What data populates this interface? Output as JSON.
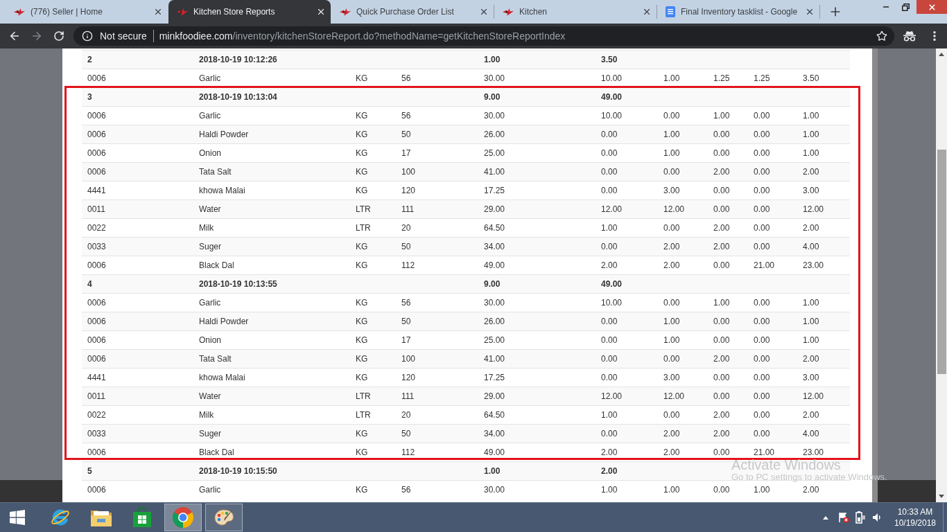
{
  "browser": {
    "tabs": [
      {
        "title": "(776) Seller | Home",
        "kind": "site",
        "selected": false
      },
      {
        "title": "Kitchen Store Reports",
        "kind": "site",
        "selected": true
      },
      {
        "title": "Quick Purchase Order List",
        "kind": "site",
        "selected": false
      },
      {
        "title": "Kitchen",
        "kind": "site",
        "selected": false
      },
      {
        "title": "Final Inventory tasklist - Google",
        "kind": "document",
        "selected": false
      }
    ],
    "navigation": {
      "forward": {
        "disabled": true
      }
    },
    "address_bar": {
      "security": "Not secure",
      "host": "minkfoodiee.com",
      "path": "/inventory/kitchenStoreReport.do?methodName=getKitchenStoreReportIndex"
    }
  },
  "report": {
    "groups": [
      {
        "highlighted": false,
        "header": {
          "column_1": "2",
          "column_2": "2018-10-19 10:12:26",
          "column_5": "1.00",
          "column_6": "3.50"
        },
        "items": [
          {
            "cells": [
              "0006",
              "Garlic",
              "KG",
              "56",
              "30.00",
              "10.00",
              "1.00",
              "1.25",
              "1.25",
              "3.50"
            ]
          }
        ]
      },
      {
        "highlighted": true,
        "header": {
          "column_1": "3",
          "column_2": "2018-10-19 10:13:04",
          "column_5": "9.00",
          "column_6": "49.00"
        },
        "items": [
          {
            "cells": [
              "0006",
              "Garlic",
              "KG",
              "56",
              "30.00",
              "10.00",
              "0.00",
              "1.00",
              "0.00",
              "1.00"
            ]
          },
          {
            "cells": [
              "0006",
              "Haldi Powder",
              "KG",
              "50",
              "26.00",
              "0.00",
              "1.00",
              "0.00",
              "0.00",
              "1.00"
            ]
          },
          {
            "cells": [
              "0006",
              "Onion",
              "KG",
              "17",
              "25.00",
              "0.00",
              "1.00",
              "0.00",
              "0.00",
              "1.00"
            ]
          },
          {
            "cells": [
              "0006",
              "Tata Salt",
              "KG",
              "100",
              "41.00",
              "0.00",
              "0.00",
              "2.00",
              "0.00",
              "2.00"
            ]
          },
          {
            "cells": [
              "4441",
              "khowa Malai",
              "KG",
              "120",
              "17.25",
              "0.00",
              "3.00",
              "0.00",
              "0.00",
              "3.00"
            ]
          },
          {
            "cells": [
              "0011",
              "Water",
              "LTR",
              "111",
              "29.00",
              "12.00",
              "12.00",
              "0.00",
              "0.00",
              "12.00"
            ]
          },
          {
            "cells": [
              "0022",
              "Milk",
              "LTR",
              "20",
              "64.50",
              "1.00",
              "0.00",
              "2.00",
              "0.00",
              "2.00"
            ]
          },
          {
            "cells": [
              "0033",
              "Suger",
              "KG",
              "50",
              "34.00",
              "0.00",
              "2.00",
              "2.00",
              "0.00",
              "4.00"
            ]
          },
          {
            "cells": [
              "0006",
              "Black Dal",
              "KG",
              "112",
              "49.00",
              "2.00",
              "2.00",
              "0.00",
              "21.00",
              "23.00"
            ]
          }
        ]
      },
      {
        "highlighted": true,
        "header": {
          "column_1": "4",
          "column_2": "2018-10-19 10:13:55",
          "column_5": "9.00",
          "column_6": "49.00"
        },
        "items": [
          {
            "cells": [
              "0006",
              "Garlic",
              "KG",
              "56",
              "30.00",
              "10.00",
              "0.00",
              "1.00",
              "0.00",
              "1.00"
            ]
          },
          {
            "cells": [
              "0006",
              "Haldi Powder",
              "KG",
              "50",
              "26.00",
              "0.00",
              "1.00",
              "0.00",
              "0.00",
              "1.00"
            ]
          },
          {
            "cells": [
              "0006",
              "Onion",
              "KG",
              "17",
              "25.00",
              "0.00",
              "1.00",
              "0.00",
              "0.00",
              "1.00"
            ]
          },
          {
            "cells": [
              "0006",
              "Tata Salt",
              "KG",
              "100",
              "41.00",
              "0.00",
              "0.00",
              "2.00",
              "0.00",
              "2.00"
            ]
          },
          {
            "cells": [
              "4441",
              "khowa Malai",
              "KG",
              "120",
              "17.25",
              "0.00",
              "3.00",
              "0.00",
              "0.00",
              "3.00"
            ]
          },
          {
            "cells": [
              "0011",
              "Water",
              "LTR",
              "111",
              "29.00",
              "12.00",
              "12.00",
              "0.00",
              "0.00",
              "12.00"
            ]
          },
          {
            "cells": [
              "0022",
              "Milk",
              "LTR",
              "20",
              "64.50",
              "1.00",
              "0.00",
              "2.00",
              "0.00",
              "2.00"
            ]
          },
          {
            "cells": [
              "0033",
              "Suger",
              "KG",
              "50",
              "34.00",
              "0.00",
              "2.00",
              "2.00",
              "0.00",
              "4.00"
            ]
          },
          {
            "cells": [
              "0006",
              "Black Dal",
              "KG",
              "112",
              "49.00",
              "2.00",
              "2.00",
              "0.00",
              "21.00",
              "23.00"
            ]
          }
        ]
      },
      {
        "highlighted": false,
        "header": {
          "column_1": "5",
          "column_2": "2018-10-19 10:15:50",
          "column_5": "1.00",
          "column_6": "2.00"
        },
        "items": [
          {
            "cells": [
              "0006",
              "Garlic",
              "KG",
              "56",
              "30.00",
              "1.00",
              "1.00",
              "0.00",
              "1.00",
              "2.00"
            ]
          }
        ]
      }
    ]
  },
  "activation_notice": {
    "title": "Activate Windows",
    "message": "Go to PC settings to activate Windows."
  },
  "taskbar": {
    "apps": [
      {
        "kind": "internet-explorer",
        "running": false,
        "selected": false
      },
      {
        "kind": "file-explorer",
        "running": false,
        "selected": false
      },
      {
        "kind": "store",
        "running": false,
        "selected": false
      },
      {
        "kind": "chrome",
        "running": true,
        "selected": true
      },
      {
        "kind": "paint",
        "running": true,
        "selected": false
      }
    ],
    "clock": {
      "time": "10:33 AM",
      "date": "10/19/2018"
    }
  }
}
